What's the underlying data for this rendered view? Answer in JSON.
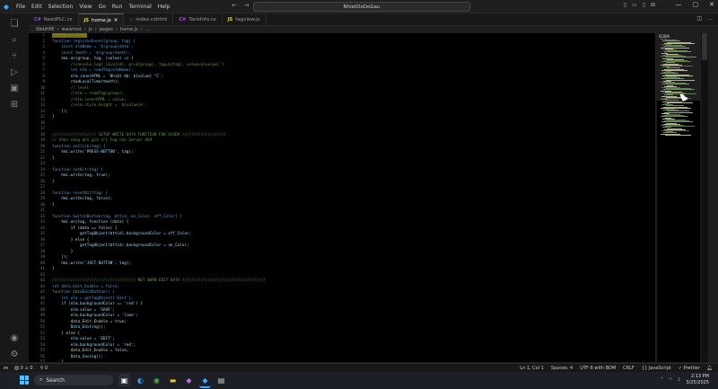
{
  "titlebar": {
    "menu": [
      "File",
      "Edit",
      "Selection",
      "View",
      "Go",
      "Run",
      "Terminal",
      "Help"
    ],
    "search_text": "NhietDoDoGau"
  },
  "tabs": [
    {
      "label": "ReadPLC.cs",
      "icon": "C#",
      "color": "#9b4dca",
      "active": false
    },
    {
      "label": "home.js",
      "icon": "JS",
      "color": "#e8d44d",
      "active": true
    },
    {
      "label": "index.cshtml",
      "icon": "◇",
      "color": "#9b4dca",
      "active": false
    },
    {
      "label": "TankInfo.cs",
      "icon": "C#",
      "color": "#9b4dca",
      "active": false
    },
    {
      "label": "tagview.js",
      "icon": "JS",
      "color": "#e8d44d",
      "active": false
    }
  ],
  "breadcrumb": [
    "WebHMI",
    "wwwroot",
    "js",
    "pages",
    "home.js",
    "..."
  ],
  "code_lines": [
    {
      "n": "1",
      "t": "//#region SCADA",
      "hl": true
    },
    {
      "n": "2",
      "t": "function registerEvent(group, tag) {"
    },
    {
      "n": "3",
      "t": "    const elmName = '$(group)data';"
    },
    {
      "n": "4",
      "t": "    const tmeth = '$(group)tmeth';"
    },
    {
      "n": "5",
      "t": "    hmi.on(group, tag, (value) => {"
    },
    {
      "n": "6",
      "t": "        //console.log(`id=${id}, gr=${group}, tag=${tag}, value=${value}`)"
    },
    {
      "n": "7",
      "t": "        let elm = readTag(elmName);"
    },
    {
      "n": "8",
      "t": "        elm.innerHTML = `Nhiệt độ: ${value} °C`;"
    },
    {
      "n": "9",
      "t": "        readLocalTime(tmeth);"
    },
    {
      "n": "10",
      "t": "        // level"
    },
    {
      "n": "11",
      "t": "        //elm = readTag(group);"
    },
    {
      "n": "12",
      "t": "        //elm.innerHTML = value;"
    },
    {
      "n": "13",
      "t": "        //elm.style.height = `${value}%`;"
    },
    {
      "n": "14",
      "t": "    });"
    },
    {
      "n": "15",
      "t": "}"
    },
    {
      "n": "16",
      "t": ""
    },
    {
      "n": "17",
      "t": ""
    },
    {
      "n": "18",
      "t": "/////////////////// SETUP WRITE DATA FUNCTION FOR SCADA ///////////////////"
    },
    {
      "n": "19",
      "t": "// Chức năng ghi giá trị tag cho Server AER"
    },
    {
      "n": "20",
      "t": "function onClick(tag) {"
    },
    {
      "n": "21",
      "t": "    hmi.write('PRESS-BUTTON', tag);"
    },
    {
      "n": "22",
      "t": "}"
    },
    {
      "n": "23",
      "t": ""
    },
    {
      "n": "24",
      "t": "function setBit(tag) {"
    },
    {
      "n": "25",
      "t": "    hmi.write(tag, true);"
    },
    {
      "n": "26",
      "t": "}"
    },
    {
      "n": "27",
      "t": ""
    },
    {
      "n": "28",
      "t": "function resetBit(tag) {"
    },
    {
      "n": "29",
      "t": "    hmi.write(tag, false);"
    },
    {
      "n": "30",
      "t": "}"
    },
    {
      "n": "31",
      "t": ""
    },
    {
      "n": "32",
      "t": "function SwitchButton(tag, bttid, on_Color, off_Color) {"
    },
    {
      "n": "33",
      "t": "    hmi.on(tag, function (data) {"
    },
    {
      "n": "34",
      "t": "        if (data == false) {"
    },
    {
      "n": "35",
      "t": "            getTagObject(bttid).backgroundColor = off_Color;"
    },
    {
      "n": "36",
      "t": "        } else {"
    },
    {
      "n": "37",
      "t": "            getTagObject(bttid).backgroundColor = on_Color;"
    },
    {
      "n": "38",
      "t": "        }"
    },
    {
      "n": "39",
      "t": "    });"
    },
    {
      "n": "40",
      "t": "    hmi.write('JACT-BUTTON', tag);"
    },
    {
      "n": "41",
      "t": "}"
    },
    {
      "n": "42",
      "t": ""
    },
    {
      "n": "43",
      "t": "//////////////////////////////////// NÚT NHẤN EDIT DATA ////////////////////////////////////"
    },
    {
      "n": "44",
      "t": "let data_Edit_Enable = false;"
    },
    {
      "n": "45",
      "t": "function dataEditButton() {"
    },
    {
      "n": "46",
      "t": "    let elm = getTagObject('Edit');"
    },
    {
      "n": "47",
      "t": "    if (elm.backgroundColor == 'red') {"
    },
    {
      "n": "48",
      "t": "        elm.value = 'SAVE';"
    },
    {
      "n": "49",
      "t": "        elm.backgroundColor = 'lime';"
    },
    {
      "n": "50",
      "t": "        data_Edit_Enable = true;"
    },
    {
      "n": "51",
      "t": "        Data_Editing();"
    },
    {
      "n": "52",
      "t": "    } else {"
    },
    {
      "n": "53",
      "t": "        elm.value = 'EDIT';"
    },
    {
      "n": "54",
      "t": "        elm.backgroundColor = 'red';"
    },
    {
      "n": "55",
      "t": "        data_Edit_Enable = false;"
    },
    {
      "n": "56",
      "t": "        Data_Saving();"
    },
    {
      "n": "57",
      "t": "    }"
    }
  ],
  "minimap_title": "SCADA",
  "statusbar": {
    "left": [
      "⨂ 0 ⚠ 0",
      "⚲ 0"
    ],
    "right": [
      "Ln 1, Col 1",
      "Spaces: 4",
      "UTF-8 with BOM",
      "CRLF",
      "{} JavaScript",
      "✓ Prettier"
    ]
  },
  "taskbar": {
    "search_label": "Search",
    "time": "2:13 PM",
    "date": "3/25/2025"
  },
  "colors": {
    "keyword": "#569cd6",
    "function": "#dcdcaa",
    "string": "#ce9178",
    "comment": "#6a9955",
    "accent": "#0078d4"
  }
}
